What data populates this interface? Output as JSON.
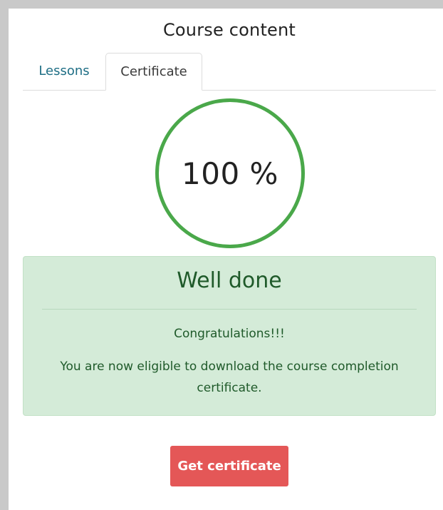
{
  "header": {
    "title": "Course content"
  },
  "tabs": [
    {
      "label": "Lessons",
      "active": false
    },
    {
      "label": "Certificate",
      "active": true
    }
  ],
  "progress": {
    "value": 100,
    "label": "100 %"
  },
  "alert": {
    "heading": "Well done",
    "message_1": "Congratulations!!!",
    "message_2": "You are now eligible to download the course completion certificate."
  },
  "actions": {
    "get_certificate_label": "Get certificate"
  },
  "colors": {
    "accent_link": "#1e6e85",
    "progress_ring": "#4aa84a",
    "success_bg": "#d4ebd8",
    "success_text": "#1f5a2a",
    "button_bg": "#e45757"
  }
}
